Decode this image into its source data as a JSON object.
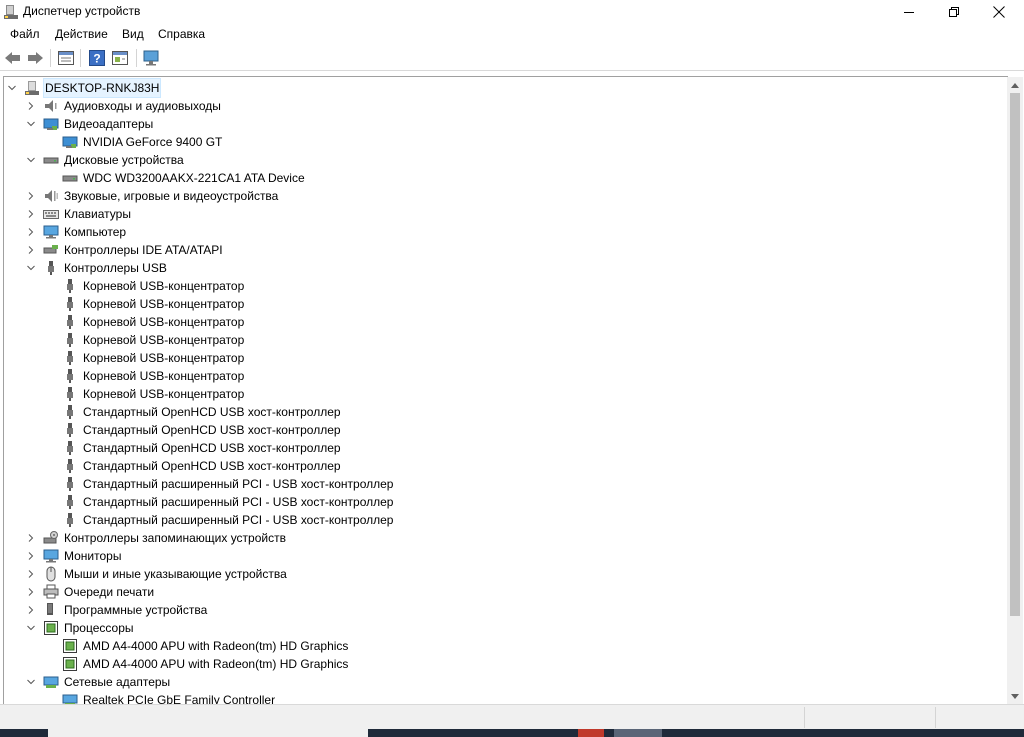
{
  "window": {
    "title": "Диспетчер устройств",
    "controls": [
      "minimize",
      "maximize",
      "close"
    ]
  },
  "menu": {
    "items": [
      "Файл",
      "Действие",
      "Вид",
      "Справка"
    ]
  },
  "toolbar": {
    "buttons": [
      "back-arrow-icon",
      "forward-arrow-icon",
      "properties-icon",
      "help-icon",
      "update-driver-icon",
      "scan-hardware-icon"
    ]
  },
  "tree": {
    "root": "DESKTOP-RNKJ83H",
    "categories": [
      {
        "label": "Аудиовходы и аудиовыходы",
        "expanded": false,
        "icon": "audio-icon",
        "children": []
      },
      {
        "label": "Видеоадаптеры",
        "expanded": true,
        "icon": "display-adapter-icon",
        "children": [
          {
            "label": "NVIDIA GeForce 9400 GT",
            "icon": "display-adapter-icon"
          }
        ]
      },
      {
        "label": "Дисковые устройства",
        "expanded": true,
        "icon": "disk-drive-icon",
        "children": [
          {
            "label": "WDC WD3200AAKX-221CA1 ATA Device",
            "icon": "disk-drive-icon"
          }
        ]
      },
      {
        "label": "Звуковые, игровые и видеоустройства",
        "expanded": false,
        "icon": "sound-icon",
        "children": []
      },
      {
        "label": "Клавиатуры",
        "expanded": false,
        "icon": "keyboard-icon",
        "children": []
      },
      {
        "label": "Компьютер",
        "expanded": false,
        "icon": "computer-icon",
        "children": []
      },
      {
        "label": "Контроллеры IDE ATA/ATAPI",
        "expanded": false,
        "icon": "ide-controller-icon",
        "children": []
      },
      {
        "label": "Контроллеры USB",
        "expanded": true,
        "icon": "usb-icon",
        "children": [
          {
            "label": "Корневой USB-концентратор",
            "icon": "usb-icon"
          },
          {
            "label": "Корневой USB-концентратор",
            "icon": "usb-icon"
          },
          {
            "label": "Корневой USB-концентратор",
            "icon": "usb-icon"
          },
          {
            "label": "Корневой USB-концентратор",
            "icon": "usb-icon"
          },
          {
            "label": "Корневой USB-концентратор",
            "icon": "usb-icon"
          },
          {
            "label": "Корневой USB-концентратор",
            "icon": "usb-icon"
          },
          {
            "label": "Корневой USB-концентратор",
            "icon": "usb-icon"
          },
          {
            "label": "Стандартный OpenHCD USB хост-контроллер",
            "icon": "usb-icon"
          },
          {
            "label": "Стандартный OpenHCD USB хост-контроллер",
            "icon": "usb-icon"
          },
          {
            "label": "Стандартный OpenHCD USB хост-контроллер",
            "icon": "usb-icon"
          },
          {
            "label": "Стандартный OpenHCD USB хост-контроллер",
            "icon": "usb-icon"
          },
          {
            "label": "Стандартный расширенный PCI - USB хост-контроллер",
            "icon": "usb-icon"
          },
          {
            "label": "Стандартный расширенный PCI - USB хост-контроллер",
            "icon": "usb-icon"
          },
          {
            "label": "Стандартный расширенный PCI - USB хост-контроллер",
            "icon": "usb-icon"
          }
        ]
      },
      {
        "label": "Контроллеры запоминающих устройств",
        "expanded": false,
        "icon": "storage-controller-icon",
        "children": []
      },
      {
        "label": "Мониторы",
        "expanded": false,
        "icon": "monitor-icon",
        "children": []
      },
      {
        "label": "Мыши и иные указывающие устройства",
        "expanded": false,
        "icon": "mouse-icon",
        "children": []
      },
      {
        "label": "Очереди печати",
        "expanded": false,
        "icon": "printer-icon",
        "children": []
      },
      {
        "label": "Программные устройства",
        "expanded": false,
        "icon": "software-device-icon",
        "children": []
      },
      {
        "label": "Процессоры",
        "expanded": true,
        "icon": "processor-icon",
        "children": [
          {
            "label": "AMD A4-4000 APU with Radeon(tm) HD Graphics",
            "icon": "processor-icon"
          },
          {
            "label": "AMD A4-4000 APU with Radeon(tm) HD Graphics",
            "icon": "processor-icon"
          }
        ]
      },
      {
        "label": "Сетевые адаптеры",
        "expanded": true,
        "icon": "network-adapter-icon",
        "children": [
          {
            "label": "Realtek PCIe GbE Family Controller",
            "icon": "network-adapter-icon"
          }
        ]
      }
    ]
  },
  "colors": {
    "selection_bg": "#e5f3ff",
    "selection_border": "#cce8ff",
    "scroll_thumb": "#c1c1c1",
    "taskbar": "#1f2a3a"
  }
}
